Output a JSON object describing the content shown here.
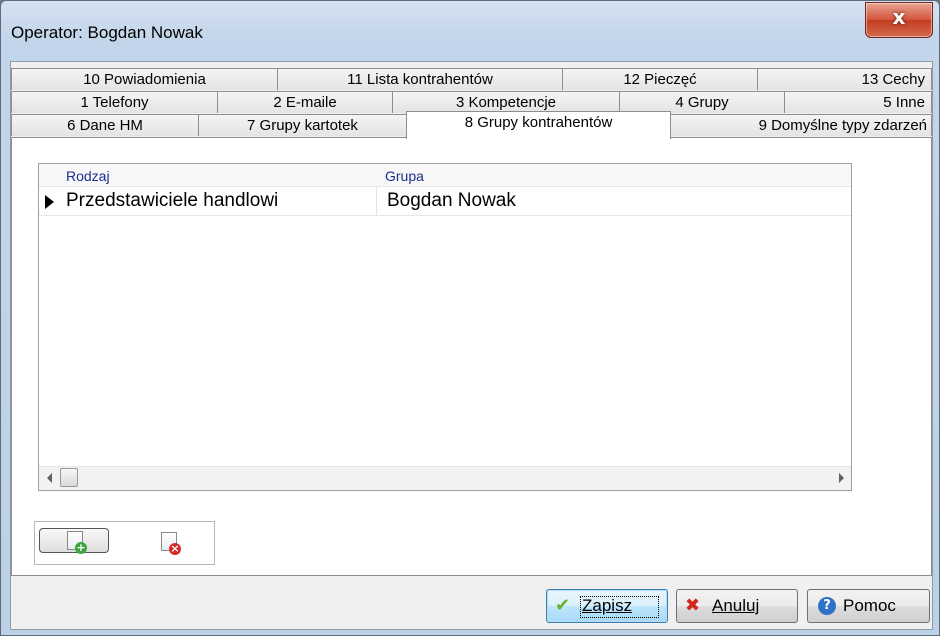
{
  "window": {
    "title": "Operator: Bogdan Nowak",
    "close_glyph": "x"
  },
  "tabs": {
    "row1": [
      {
        "label": "10 Powiadomienia"
      },
      {
        "label": "11 Lista kontrahentów"
      },
      {
        "label": "12 Pieczęć"
      },
      {
        "label": "13 Cechy"
      }
    ],
    "row2": [
      {
        "label": "1 Telefony"
      },
      {
        "label": "2 E-maile"
      },
      {
        "label": "3 Kompetencje"
      },
      {
        "label": "4 Grupy"
      },
      {
        "label": "5 Inne"
      }
    ],
    "row3": [
      {
        "label": "6 Dane HM"
      },
      {
        "label": "7 Grupy kartotek"
      },
      {
        "label": "8 Grupy kontrahentów"
      },
      {
        "label": "9 Domyślne typy zdarzeń"
      }
    ],
    "active": "8 Grupy kontrahentów"
  },
  "grid": {
    "columns": [
      "Rodzaj",
      "Grupa"
    ],
    "rows": [
      {
        "rodzaj": "Przedstawiciele handlowi",
        "grupa": "Bogdan Nowak"
      }
    ]
  },
  "toolbar": {
    "add_icon": "add-document-icon",
    "delete_icon": "delete-document-icon"
  },
  "footer": {
    "save_label": "Zapisz",
    "cancel_label": "Anuluj",
    "help_label": "Pomoc"
  },
  "colors": {
    "header_text": "#1a2f8c",
    "default_button_border": "#3c7fb1",
    "close_button": "#c23d20"
  }
}
